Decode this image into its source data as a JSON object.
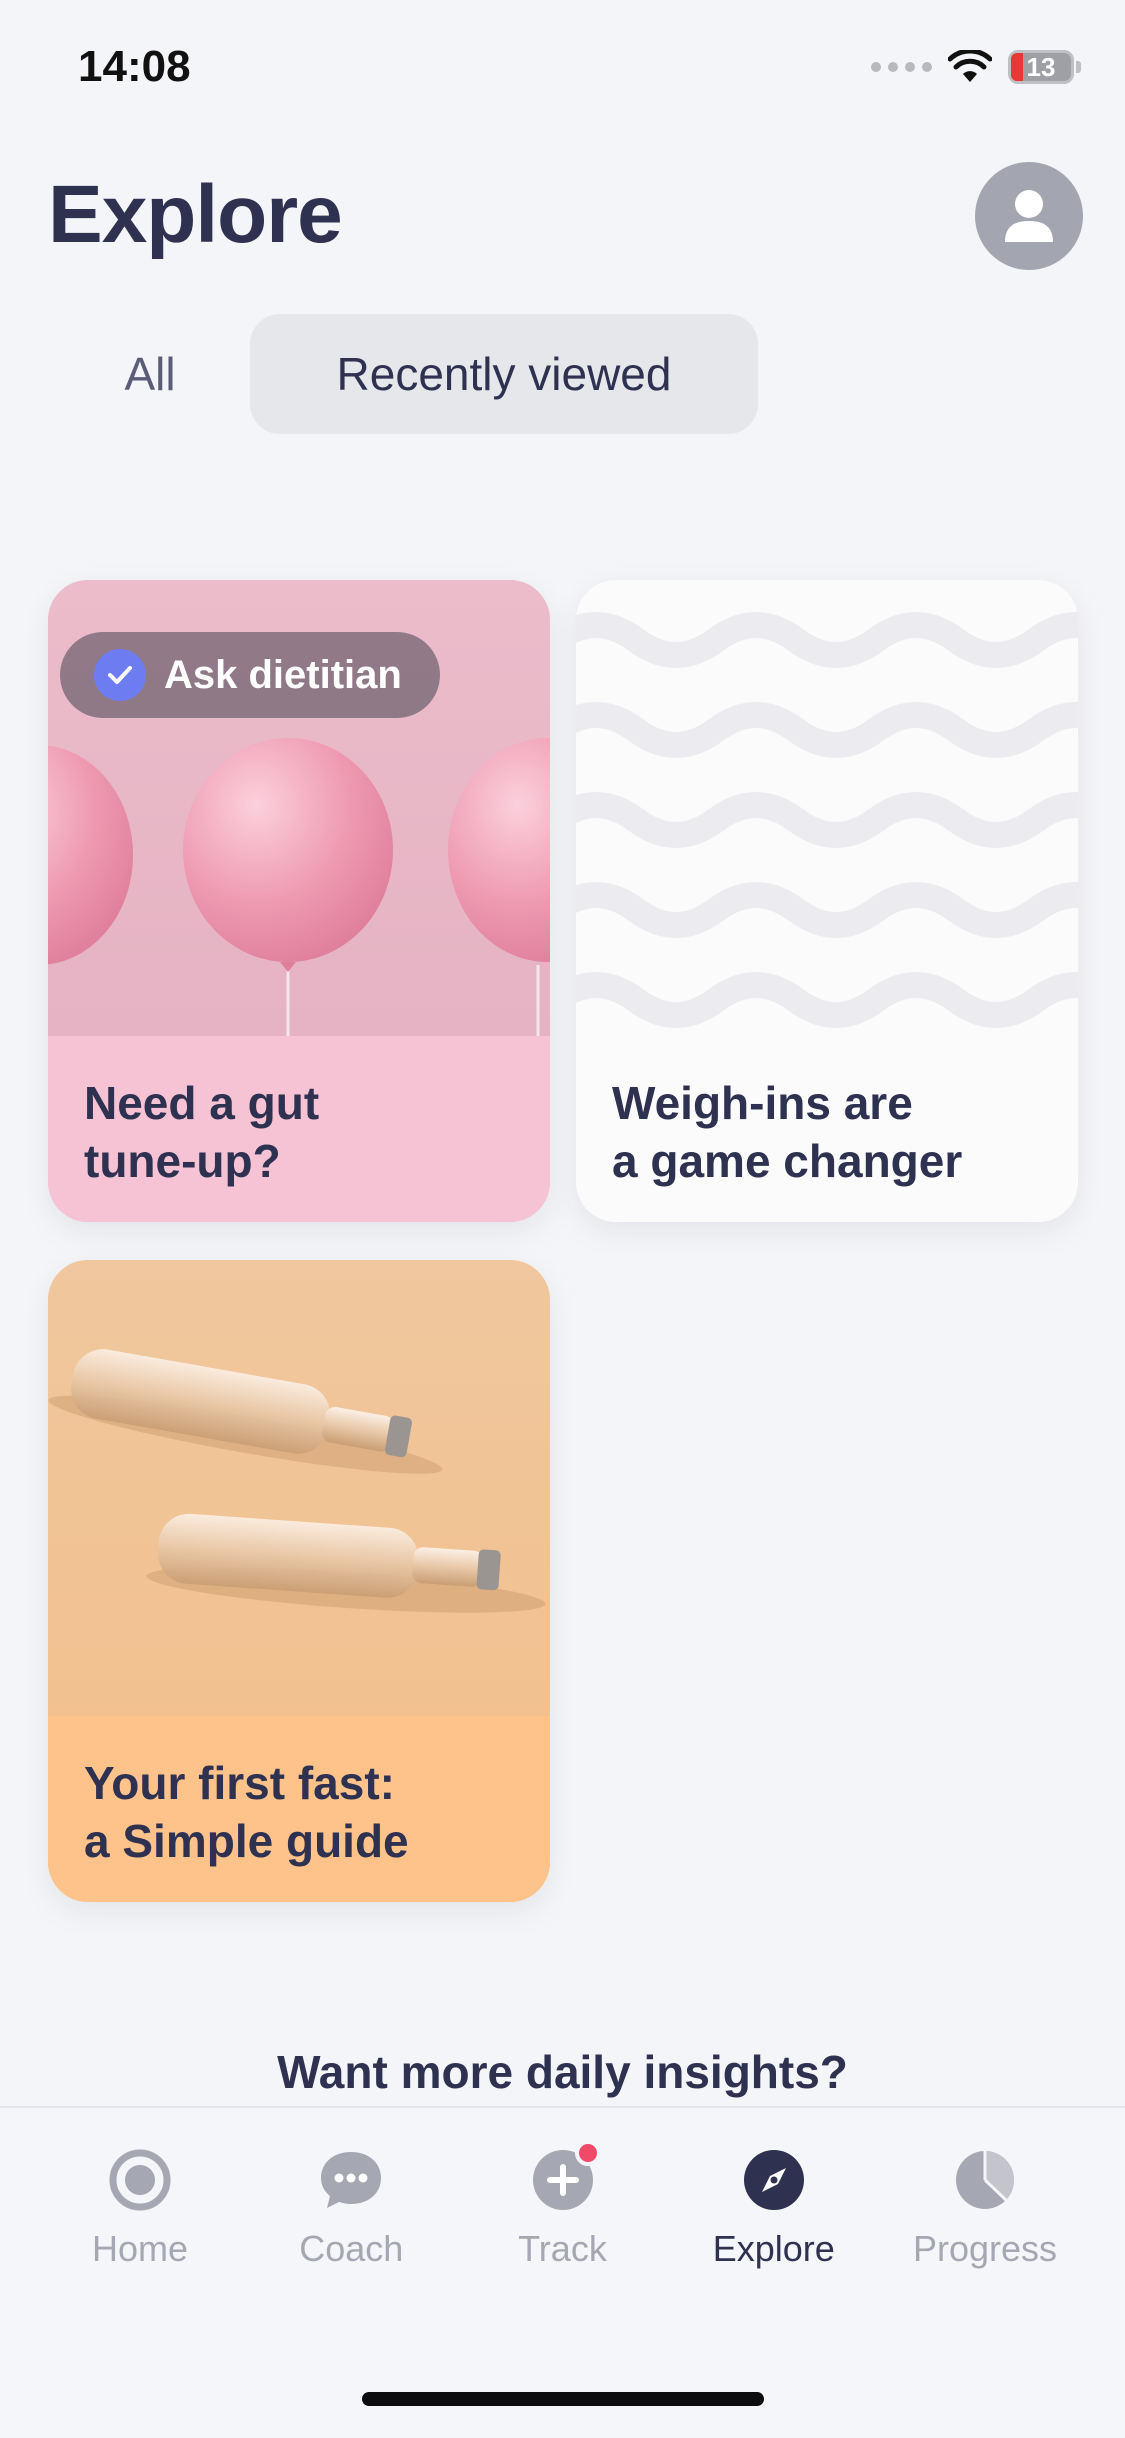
{
  "status_bar": {
    "time": "14:08",
    "battery": "13"
  },
  "header": {
    "title": "Explore"
  },
  "tabs": [
    {
      "label": "All",
      "selected": false
    },
    {
      "label": "Recently viewed",
      "selected": true
    }
  ],
  "cards": [
    {
      "title": "Need a gut\ntune-up?",
      "badge": "Ask dietitian",
      "image": "pink-balloons"
    },
    {
      "title": "Weigh-ins are\na game changer",
      "image": "wave-pattern"
    },
    {
      "title": "Your first fast:\na Simple guide",
      "image": "glass-bottles"
    }
  ],
  "promo": {
    "text": "Want more daily insights?"
  },
  "tabbar": {
    "items": [
      {
        "label": "Home",
        "icon": "home-icon",
        "active": false
      },
      {
        "label": "Coach",
        "icon": "chat-bubble-icon",
        "active": false
      },
      {
        "label": "Track",
        "icon": "plus-circle-icon",
        "active": false,
        "has_notification": true
      },
      {
        "label": "Explore",
        "icon": "compass-icon",
        "active": true
      },
      {
        "label": "Progress",
        "icon": "pie-chart-icon",
        "active": false
      }
    ]
  },
  "colors": {
    "accent": "#2f3150",
    "card_pink": "#f5c3d4",
    "card_orange": "#fdc38b",
    "badge_check": "#6d7cf0",
    "notification": "#f04a68"
  }
}
